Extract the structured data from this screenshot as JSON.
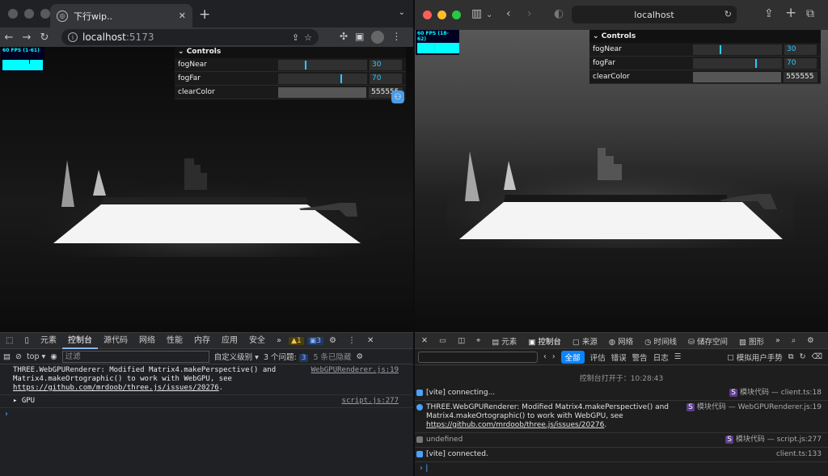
{
  "left": {
    "tab_title": "下行wip..",
    "favicon": "globe-icon",
    "url_host": "localhost",
    "url_port": ":5173",
    "fps": "60 FPS (1-61)",
    "gui": {
      "title": "Controls",
      "fogNear": {
        "label": "fogNear",
        "value": "30",
        "fraction": 0.3
      },
      "fogFar": {
        "label": "fogFar",
        "value": "70",
        "fraction": 0.7
      },
      "clearColor": {
        "label": "clearColor",
        "value": "555555"
      }
    },
    "devtools": {
      "tabs": [
        "元素",
        "控制台",
        "源代码",
        "网络",
        "性能",
        "内存",
        "应用",
        "安全"
      ],
      "warn_count": "1",
      "info_count": "3",
      "context": "top",
      "filter_placeholder": "过滤",
      "levels": "自定义级别",
      "issues": "3 个问题:",
      "issues_count": "3",
      "hidden": "5 条已隐藏",
      "msg1": "THREE.WebGPURenderer: Modified Matrix4.makePerspective() and Matrix4.makeOrtographic() to work with WebGPU, see ",
      "msg1_link": "https://github.com/mrdoob/three.js/issues/20276",
      "msg1_src": "WebGPURenderer.js:19",
      "msg2": "GPU",
      "msg2_src": "script.js:277"
    }
  },
  "right": {
    "url": "localhost",
    "fps": "60 FPS (18-62)",
    "gui": {
      "title": "Controls",
      "fogNear": {
        "label": "fogNear",
        "value": "30",
        "fraction": 0.3
      },
      "fogFar": {
        "label": "fogFar",
        "value": "70",
        "fraction": 0.7
      },
      "clearColor": {
        "label": "clearColor",
        "value": "555555"
      }
    },
    "devtools": {
      "tabs": [
        "元素",
        "控制台",
        "来源",
        "网络",
        "时间线",
        "储存空间",
        "图形"
      ],
      "levels": [
        "全部",
        "评估",
        "错误",
        "警告",
        "日志"
      ],
      "mock": "模拟用户手势",
      "opened": "控制台打开于：10:28:43",
      "m1": "[vite] connecting...",
      "m1_badge": "S",
      "m1_mod": "模块代码",
      "m1_src": "— client.ts:18",
      "m2": "THREE.WebGPURenderer: Modified Matrix4.makePerspective() and Matrix4.makeOrtographic() to work with WebGPU, see ",
      "m2_link": "https://github.com/mrdoob/three.js/issues/20276",
      "m2_end": ".",
      "m2_badge": "S",
      "m2_mod": "模块代码",
      "m2_src": "— WebGPURenderer.js:19",
      "m3": "undefined",
      "m3_badge": "S",
      "m3_mod": "模块代码",
      "m3_src": "— script.js:277",
      "m4": "[vite] connected.",
      "m4_src": "client.ts:133"
    }
  }
}
